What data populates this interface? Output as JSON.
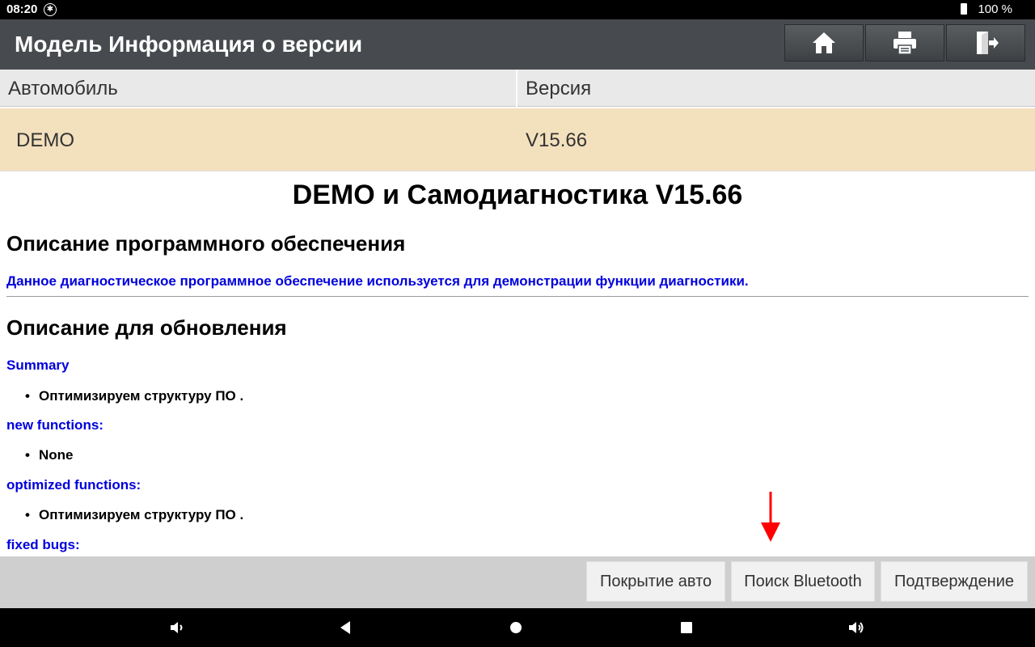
{
  "status_bar": {
    "time": "08:20",
    "battery": "100 %",
    "icons": [
      "bluetooth-icon",
      "battery-icon"
    ]
  },
  "header": {
    "title": "Модель Информация о версии",
    "buttons": [
      {
        "icon": "home-icon"
      },
      {
        "icon": "print-icon"
      },
      {
        "icon": "exit-icon"
      }
    ]
  },
  "table": {
    "columns": [
      "Автомобиль",
      "Версия"
    ],
    "rows": [
      {
        "vehicle": "DEMO",
        "version": "V15.66"
      }
    ],
    "selected_row_color": "#f3e0bd"
  },
  "content": {
    "title": "DEMO и Самодиагностика V15.66",
    "software_heading": "Описание программного обеспечения",
    "software_text": "Данное диагностическое программное обеспечение используется для демонстрации функции диагностики.",
    "update_heading": "Описание для обновления",
    "sections": [
      {
        "label": "Summary",
        "items": [
          "Оптимизируем структуру ПО ."
        ]
      },
      {
        "label": "new functions:",
        "items": [
          "None"
        ]
      },
      {
        "label": "optimized functions:",
        "items": [
          "Оптимизируем структуру ПО ."
        ]
      },
      {
        "label": "fixed bugs:",
        "items": []
      }
    ],
    "link_color": "#0000dd"
  },
  "bottom_bar": {
    "buttons": [
      "Покрытие авто",
      "Поиск Bluetooth",
      "Подтверждение"
    ]
  },
  "nav_bar": {
    "icons": [
      "volume-down-icon",
      "back-icon",
      "home-circle-icon",
      "recents-icon",
      "volume-up-icon"
    ]
  },
  "annotation": {
    "color": "#ff0000",
    "icon": "red-arrow-down-icon"
  }
}
